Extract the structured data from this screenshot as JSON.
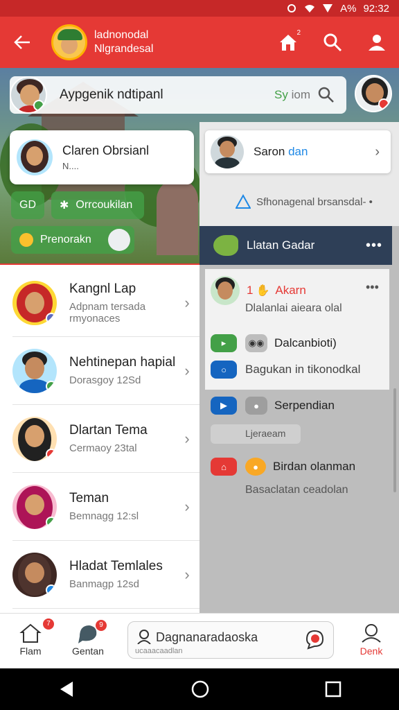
{
  "status_bar": {
    "battery_text": "A%",
    "time": "92:32"
  },
  "app_bar": {
    "title_line1": "ladnonodal",
    "title_line2": "Nlgrandesal",
    "home_badge": "2"
  },
  "search_bar": {
    "text": "Aypgenik ndtipanl",
    "hint_prefix": "Sy",
    "hint_suffix": " iom"
  },
  "profile_card": {
    "name": "Claren Obrsianl",
    "subtitle": "N...."
  },
  "chips": [
    {
      "label": "GD",
      "color": "#43a047"
    },
    {
      "label": "Orrcoukilan",
      "color": "#43a047"
    },
    {
      "label": "Prenorakn",
      "color": "#43a047"
    }
  ],
  "left_list": [
    {
      "name": "Kangnl Lap",
      "sub1": "Adpnam tersada",
      "sub2": "rmyonaces",
      "badge_color": "#5c6bc0"
    },
    {
      "name": "Nehtinepan  hapial",
      "sub1": "Dorasgoy 12Sd",
      "sub2": "",
      "badge_color": "#43a047"
    },
    {
      "name": "Dlartan Tema",
      "sub1": "Cermaoy 23tal",
      "sub2": "",
      "badge_color": "#e53935"
    },
    {
      "name": "Teman",
      "sub1": "Bemnagg 12:sl",
      "sub2": "",
      "badge_color": "#43a047"
    },
    {
      "name": "Hladat Temlales",
      "sub1": "Banmagp 12sd",
      "sub2": "",
      "badge_color": "#1e88e5"
    }
  ],
  "right_panel": {
    "card": {
      "name_a": "Saron",
      "name_b": " dan"
    },
    "line": "Sfhonagenal brsansdal- •",
    "dark_row": "Llatan Gadar",
    "item1": {
      "prefix": "1",
      "label": "Akarn",
      "sub": "Dlalanlai aieara olal"
    },
    "item2": {
      "label": "Dalcanbioti)"
    },
    "item3": {
      "label": "Bagukan in tikonodkal"
    },
    "item4": {
      "label": "Serpendian",
      "sub": "Ljeraeam"
    },
    "item5": {
      "label": "Birdan olanman",
      "sub": "Basaclatan ceadolan"
    }
  },
  "bottom_nav": [
    {
      "label": "Flam",
      "badge": "7"
    },
    {
      "label": "Gentan",
      "badge": "9"
    },
    {
      "label": "Denk",
      "badge": ""
    }
  ],
  "bottom_search": {
    "text": "Dagnanaradaoska",
    "sub": "ucaaacaadlan"
  }
}
